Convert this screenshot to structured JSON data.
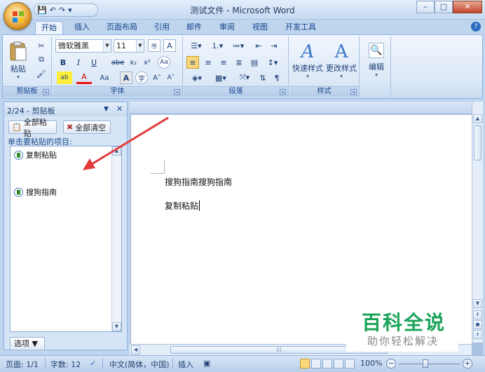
{
  "window": {
    "title": "测试文件 - Microsoft Word",
    "controls": {
      "minimize": "–",
      "maximize": "□",
      "close": "✕"
    }
  },
  "qat": {
    "save": "💾",
    "undo": "↶",
    "redo": "↷",
    "more": "▾"
  },
  "ribbon": {
    "tabs": [
      {
        "label": "开始",
        "active": true
      },
      {
        "label": "插入"
      },
      {
        "label": "页面布局"
      },
      {
        "label": "引用"
      },
      {
        "label": "邮件"
      },
      {
        "label": "审阅"
      },
      {
        "label": "视图"
      },
      {
        "label": "开发工具"
      }
    ],
    "help": "?",
    "clipboard": {
      "label": "剪贴板",
      "paste": "粘贴"
    },
    "font": {
      "label": "字体",
      "name": "微软雅黑",
      "size": "11",
      "bold": "B",
      "italic": "I",
      "underline": "U",
      "strike": "abe",
      "subscript": "x₂",
      "superscript": "x²",
      "font_color": "A",
      "change_case": "Aa",
      "grow": "A˄",
      "shrink": "A˅",
      "char_border": "A",
      "phonetic": "㊢"
    },
    "paragraph": {
      "label": "段落"
    },
    "styles": {
      "label": "样式",
      "quick": "快速样式",
      "change": "更改样式"
    },
    "editing": {
      "label": "编辑"
    }
  },
  "clipboard_pane": {
    "title": "2/24 - 剪贴板",
    "menu": "▼",
    "close": "✕",
    "paste_all": "全部粘贴",
    "clear_all": "全部清空",
    "hint": "单击要粘贴的项目:",
    "items": [
      "复制粘贴",
      "搜狗指南"
    ],
    "options": "选项 ▼"
  },
  "document": {
    "lines": [
      "搜狗指南搜狗指南",
      "复制粘贴"
    ]
  },
  "watermark": {
    "title": "百科全说",
    "subtitle": "助你轻松解决"
  },
  "status": {
    "page": "页面: 1/1",
    "words": "字数: 12",
    "language": "中文(简体，中国)",
    "mode": "插入",
    "zoom": "100%",
    "zoom_minus": "−",
    "zoom_plus": "+"
  },
  "colors": {
    "accent": "#c6d9f1",
    "arrow": "#e23a3a",
    "watermark": "#1aa35a"
  }
}
